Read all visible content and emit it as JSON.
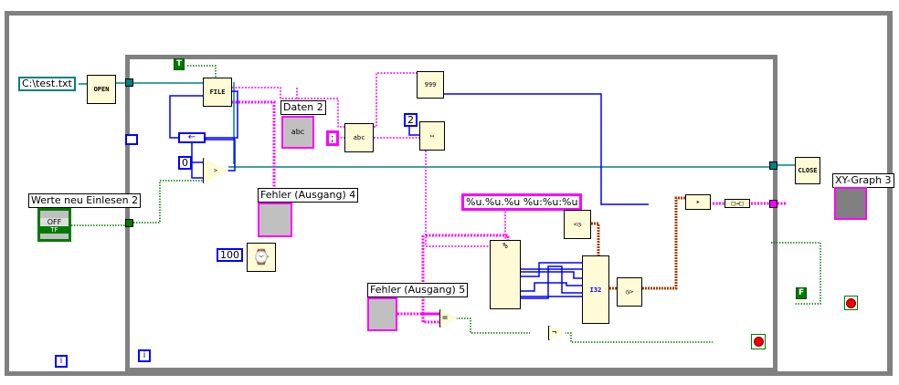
{
  "diagram": {
    "path_constant": "C:\\test.txt",
    "open_node": "OPEN",
    "close_node": "CLOSE",
    "read_node": "FILE",
    "true_constant": "T",
    "false_constant": "F",
    "daten_label": "Daten 2",
    "daten_indicator_text": "abc",
    "separator_constant": ";",
    "index_constant": "2",
    "zero_constant": "0",
    "wait_constant": "100",
    "button_label": "Werte neu Einlesen 2",
    "button_text": "OFF",
    "button_type": "TF",
    "error_label_4": "Fehler (Ausgang) 4",
    "error_label_5": "Fehler (Ausgang) 5",
    "format_string": "%u.%u.%u %u:%u:%u",
    "xy_graph_label": "XY-Graph 3",
    "scan_node_text": "999",
    "i32_label": "I32",
    "iteration_icon": "i",
    "equal_symbol": "=",
    "not_symbol": "¬"
  },
  "colors": {
    "frame": "#808080",
    "string_wire": "#ff00ff",
    "numeric_wire": "#0000ff",
    "refnum_wire": "#008080",
    "boolean_wire": "#007a00",
    "timestamp_wire": "#a04000",
    "node_fill": "#fffbd6"
  },
  "icons": [
    "file-open-icon",
    "file-read-icon",
    "shift-register-icon",
    "select-icon",
    "wait-ms-icon",
    "scan-from-string-icon",
    "format-into-string-icon",
    "seconds-to-date-icon",
    "build-array-icon",
    "bundle-icon",
    "xy-graph-icon",
    "stop-icon",
    "file-close-icon",
    "loop-iteration-icon"
  ]
}
